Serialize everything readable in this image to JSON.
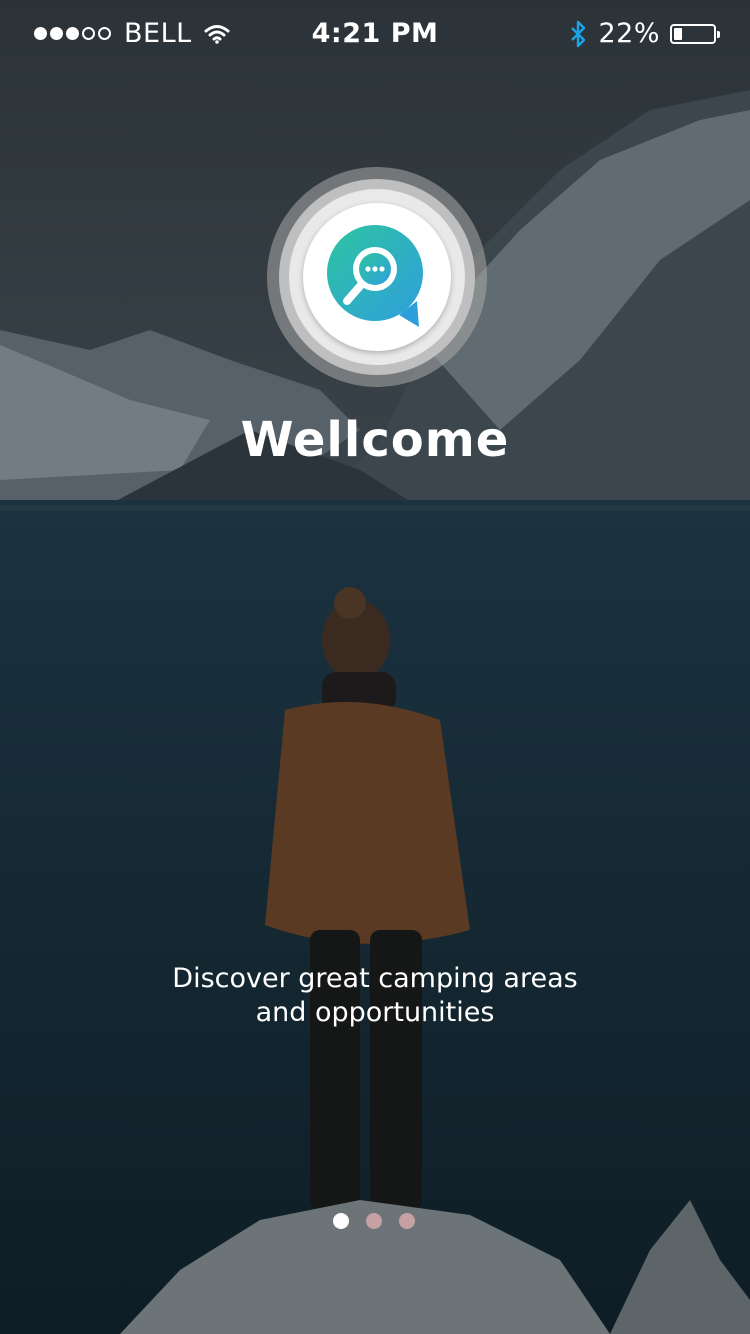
{
  "status_bar": {
    "signal_filled": 3,
    "signal_total": 5,
    "carrier": "BELL",
    "time": "4:21 PM",
    "battery_percent": "22%",
    "battery_level": 0.22,
    "icons": [
      "wifi-icon",
      "bluetooth-icon",
      "battery-icon"
    ]
  },
  "logo": {
    "icon": "search-chat-icon",
    "gradient": [
      "#2ec4a0",
      "#2f9fdc"
    ]
  },
  "welcome": {
    "title": "Wellcome",
    "subtitle_line1": "Discover great camping areas",
    "subtitle_line2": "and opportunities"
  },
  "pager": {
    "count": 3,
    "active_index": 0,
    "active_color": "#ffffff",
    "inactive_color": "#c7a0a3"
  },
  "colors": {
    "accent": "#2fb6b8",
    "bluetooth": "#1aa3e8"
  }
}
